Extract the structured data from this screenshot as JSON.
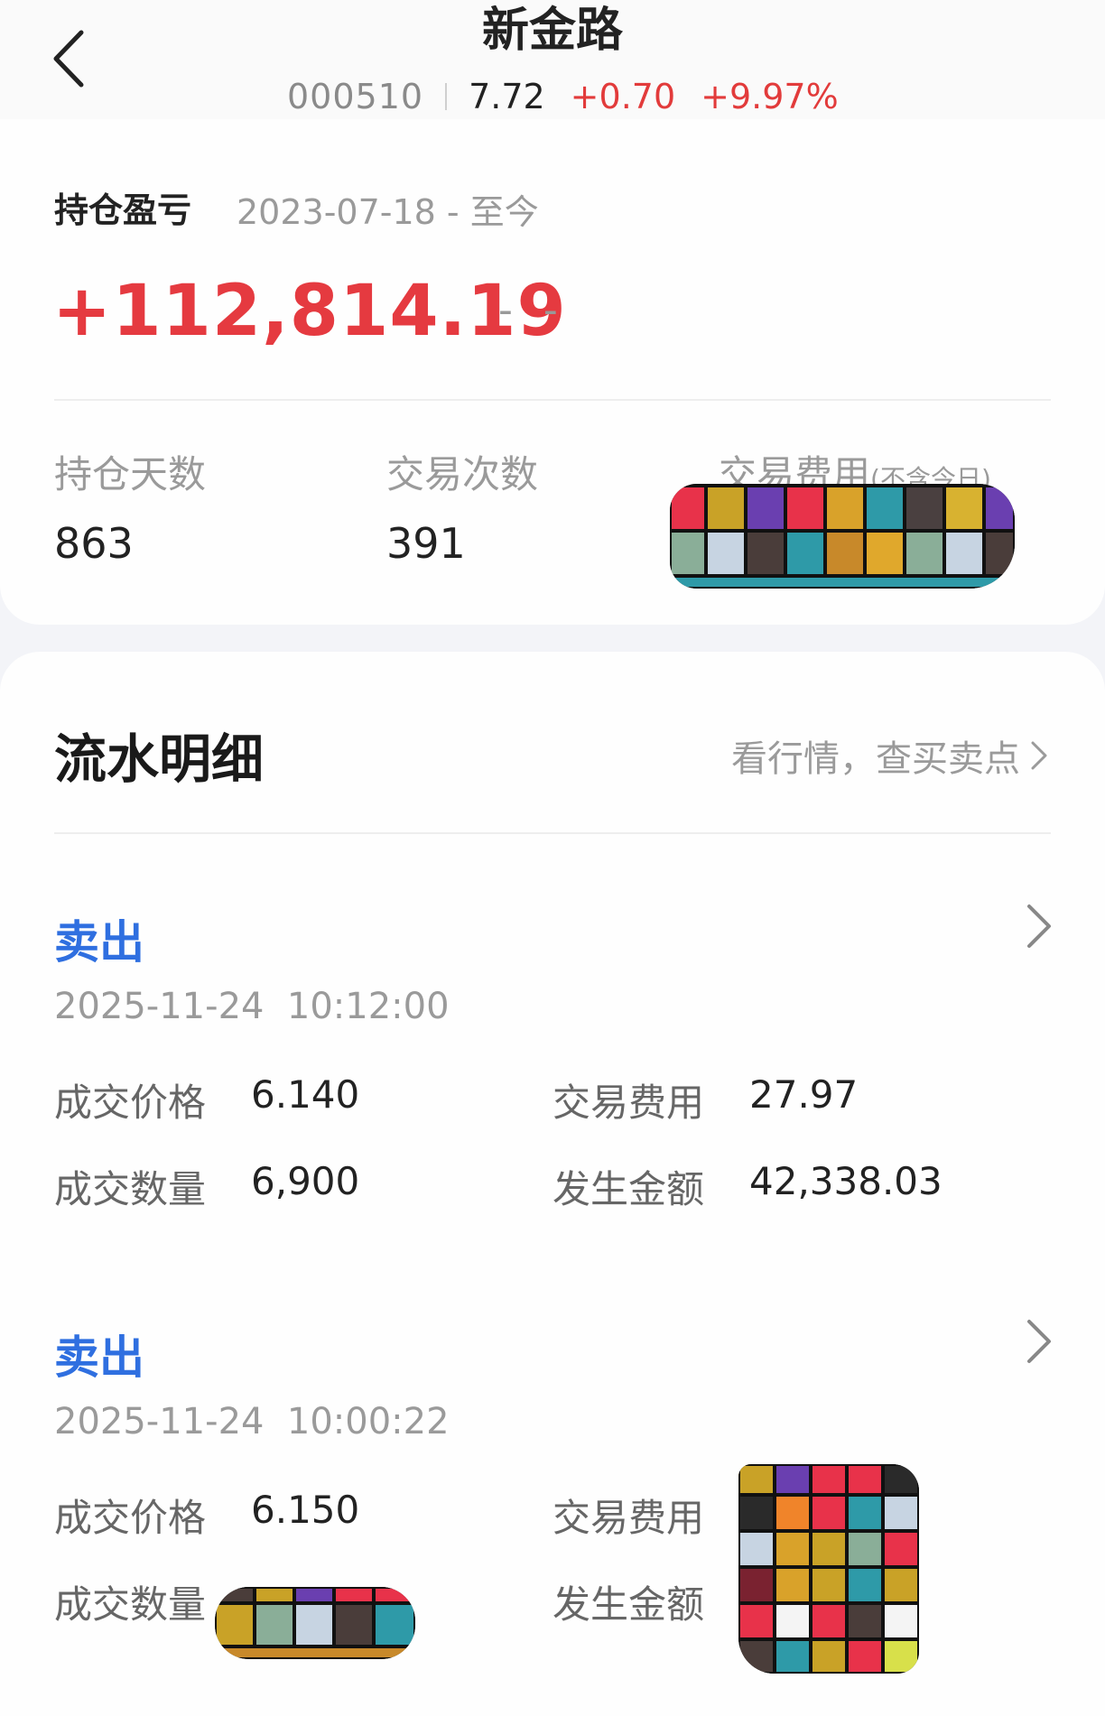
{
  "header": {
    "title": "新金路",
    "code": "000510",
    "price": "7.72",
    "change": "+0.70",
    "change_pct": "+9.97%"
  },
  "pnl": {
    "label": "持仓盈亏",
    "period": "2023-07-18 - 至今",
    "value": "+112,814.19",
    "secondary": "- -"
  },
  "stats": [
    {
      "label": "持仓天数",
      "value": "863"
    },
    {
      "label": "交易次数",
      "value": "391"
    },
    {
      "label": "交易费用",
      "note": "(不含今日)",
      "value": ""
    }
  ],
  "flow": {
    "title": "流水明细",
    "link": "看行情，查买卖点"
  },
  "field_labels": {
    "price": "成交价格",
    "fee": "交易费用",
    "qty": "成交数量",
    "amount": "发生金额"
  },
  "entries": [
    {
      "type": "卖出",
      "date": "2025-11-24",
      "time": "10:12:00",
      "price": "6.140",
      "fee": "27.97",
      "qty": "6,900",
      "amount": "42,338.03"
    },
    {
      "type": "卖出",
      "date": "2025-11-24",
      "time": "10:00:22",
      "price": "6.150",
      "fee": "",
      "qty": "",
      "amount": ""
    }
  ],
  "colors": {
    "up_red": "#e53a40",
    "accent_blue": "#2f6fe0",
    "muted": "#9a9a9a"
  }
}
